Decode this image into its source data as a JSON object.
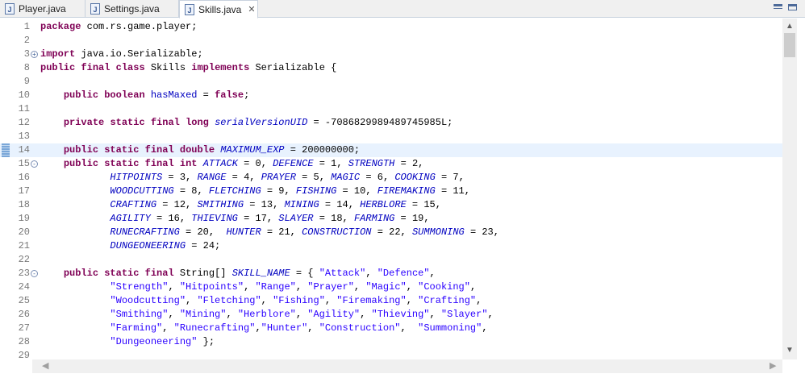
{
  "tabs": [
    {
      "label": "Player.java",
      "icon": "java-file-icon"
    },
    {
      "label": "Settings.java",
      "icon": "java-file-icon"
    },
    {
      "label": "Skills.java",
      "icon": "java-file-icon",
      "active": true
    }
  ],
  "editor": {
    "lines": [
      {
        "n": "1",
        "src": "package com.rs.game.player;"
      },
      {
        "n": "2",
        "src": ""
      },
      {
        "n": "3",
        "src": "import java.io.Serializable;"
      },
      {
        "n": "8",
        "src": "public final class Skills implements Serializable {"
      },
      {
        "n": "9",
        "src": ""
      },
      {
        "n": "10",
        "src": "    public boolean hasMaxed = false;"
      },
      {
        "n": "11",
        "src": ""
      },
      {
        "n": "12",
        "src": "    private static final long serialVersionUID = -7086829989489745985L;"
      },
      {
        "n": "13",
        "src": ""
      },
      {
        "n": "14",
        "src": "    public static final double MAXIMUM_EXP = 200000000;"
      },
      {
        "n": "15",
        "src": "    public static final int ATTACK = 0, DEFENCE = 1, STRENGTH = 2,"
      },
      {
        "n": "16",
        "src": "            HITPOINTS = 3, RANGE = 4, PRAYER = 5, MAGIC = 6, COOKING = 7,"
      },
      {
        "n": "17",
        "src": "            WOODCUTTING = 8, FLETCHING = 9, FISHING = 10, FIREMAKING = 11,"
      },
      {
        "n": "18",
        "src": "            CRAFTING = 12, SMITHING = 13, MINING = 14, HERBLORE = 15,"
      },
      {
        "n": "19",
        "src": "            AGILITY = 16, THIEVING = 17, SLAYER = 18, FARMING = 19,"
      },
      {
        "n": "20",
        "src": "            RUNECRAFTING = 20,  HUNTER = 21, CONSTRUCTION = 22, SUMMONING = 23,"
      },
      {
        "n": "21",
        "src": "            DUNGEONEERING = 24;"
      },
      {
        "n": "22",
        "src": ""
      },
      {
        "n": "23",
        "src": "    public static final String[] SKILL_NAME = { \"Attack\", \"Defence\","
      },
      {
        "n": "24",
        "src": "            \"Strength\", \"Hitpoints\", \"Range\", \"Prayer\", \"Magic\", \"Cooking\","
      },
      {
        "n": "25",
        "src": "            \"Woodcutting\", \"Fletching\", \"Fishing\", \"Firemaking\", \"Crafting\","
      },
      {
        "n": "26",
        "src": "            \"Smithing\", \"Mining\", \"Herblore\", \"Agility\", \"Thieving\", \"Slayer\","
      },
      {
        "n": "27",
        "src": "            \"Farming\", \"Runecrafting\",\"Hunter\", \"Construction\",  \"Summoning\","
      },
      {
        "n": "28",
        "src": "            \"Dungeoneering\" };"
      },
      {
        "n": "29",
        "src": ""
      }
    ],
    "current_line": "14",
    "fold_lines": {
      "3": "+",
      "15": "-",
      "23": "-"
    },
    "syntax_colors": {
      "keyword": "#7f0055",
      "field": "#0000c0",
      "string": "#2a00ff",
      "current_line_bg": "#e8f2fe"
    }
  }
}
